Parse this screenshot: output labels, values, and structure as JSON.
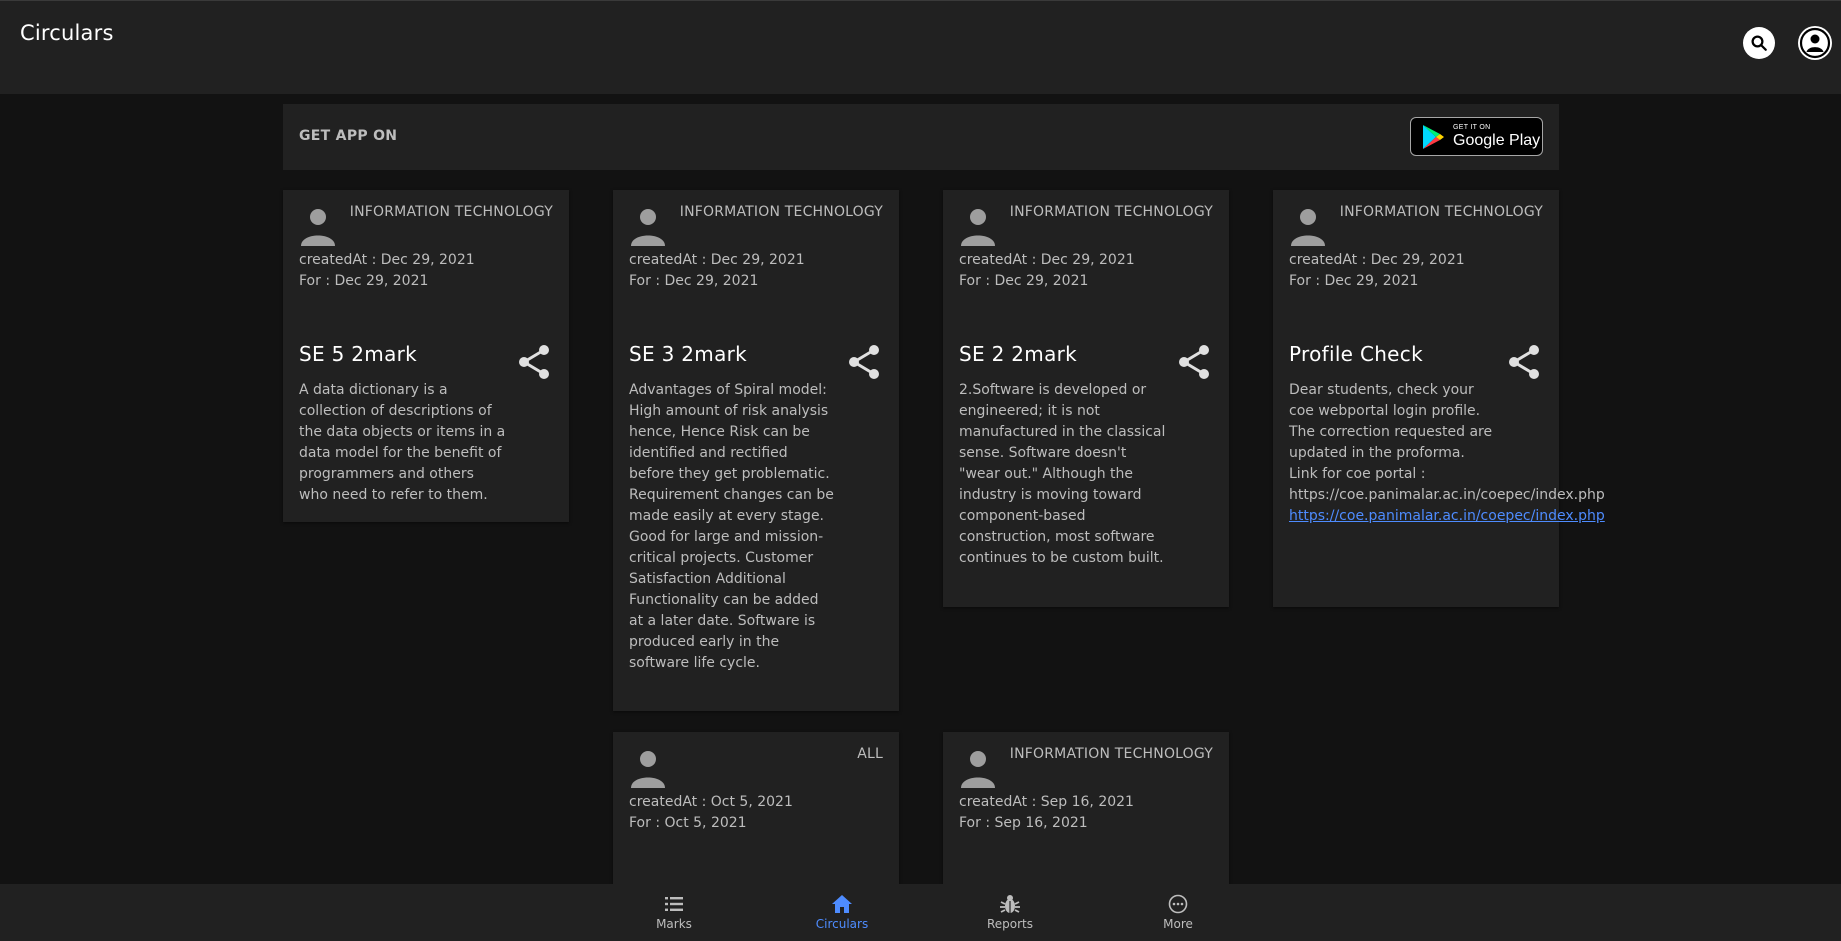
{
  "app": {
    "title": "Circulars"
  },
  "banner": {
    "label": "GET APP ON",
    "badge_small": "GET IT ON",
    "badge_big": "Google Play"
  },
  "cards": [
    {
      "department": "INFORMATION TECHNOLOGY",
      "created": "createdAt : Dec 29, 2021",
      "for": "For : Dec 29, 2021",
      "title": "SE 5 2mark",
      "body": "A data dictionary is a collection of descriptions of the data objects or items in a data model for the benefit of programmers and others who need to refer to them."
    },
    {
      "department": "INFORMATION TECHNOLOGY",
      "created": "createdAt : Dec 29, 2021",
      "for": "For : Dec 29, 2021",
      "title": "SE 3 2mark",
      "body": "Advantages of Spiral model: High amount of risk analysis hence, Hence Risk can be identified and rectified before they get problematic. Requirement changes can be made easily at every stage. Good for large and mission-critical projects. Customer Satisfaction Additional Functionality can be added at a later date. Software is produced early in the software life cycle."
    },
    {
      "department": "INFORMATION TECHNOLOGY",
      "created": "createdAt : Dec 29, 2021",
      "for": "For : Dec 29, 2021",
      "title": "SE 2 2mark",
      "body": "2.Software is developed or engineered; it is not manufactured in the classical sense. Software doesn't \"wear out.\" Although the industry is moving toward component-based construction, most software continues to be custom built."
    },
    {
      "department": "INFORMATION TECHNOLOGY",
      "created": "createdAt : Dec 29, 2021",
      "for": "For : Dec 29, 2021",
      "title": "Profile Check",
      "body": "Dear students, check your coe webportal login profile. The correction requested are updated in the proforma. Link for coe portal : https://coe.panimalar.ac.in/coepec/index.php",
      "link": "https://coe.panimalar.ac.in/coepec/index.php"
    },
    {
      "department": "ALL",
      "created": "createdAt : Oct 5, 2021",
      "for": "For : Oct 5, 2021"
    },
    {
      "department": "INFORMATION TECHNOLOGY",
      "created": "createdAt : Sep 16, 2021",
      "for": "For : Sep 16, 2021"
    }
  ],
  "nav": {
    "items": [
      {
        "label": "Marks",
        "icon": "list-icon"
      },
      {
        "label": "Circulars",
        "icon": "home-icon",
        "active": true
      },
      {
        "label": "Reports",
        "icon": "bug-icon"
      },
      {
        "label": "More",
        "icon": "more-horizontal-icon"
      }
    ]
  },
  "colors": {
    "accent": "#4e8cff",
    "surface": "#212121",
    "background": "#121212"
  }
}
